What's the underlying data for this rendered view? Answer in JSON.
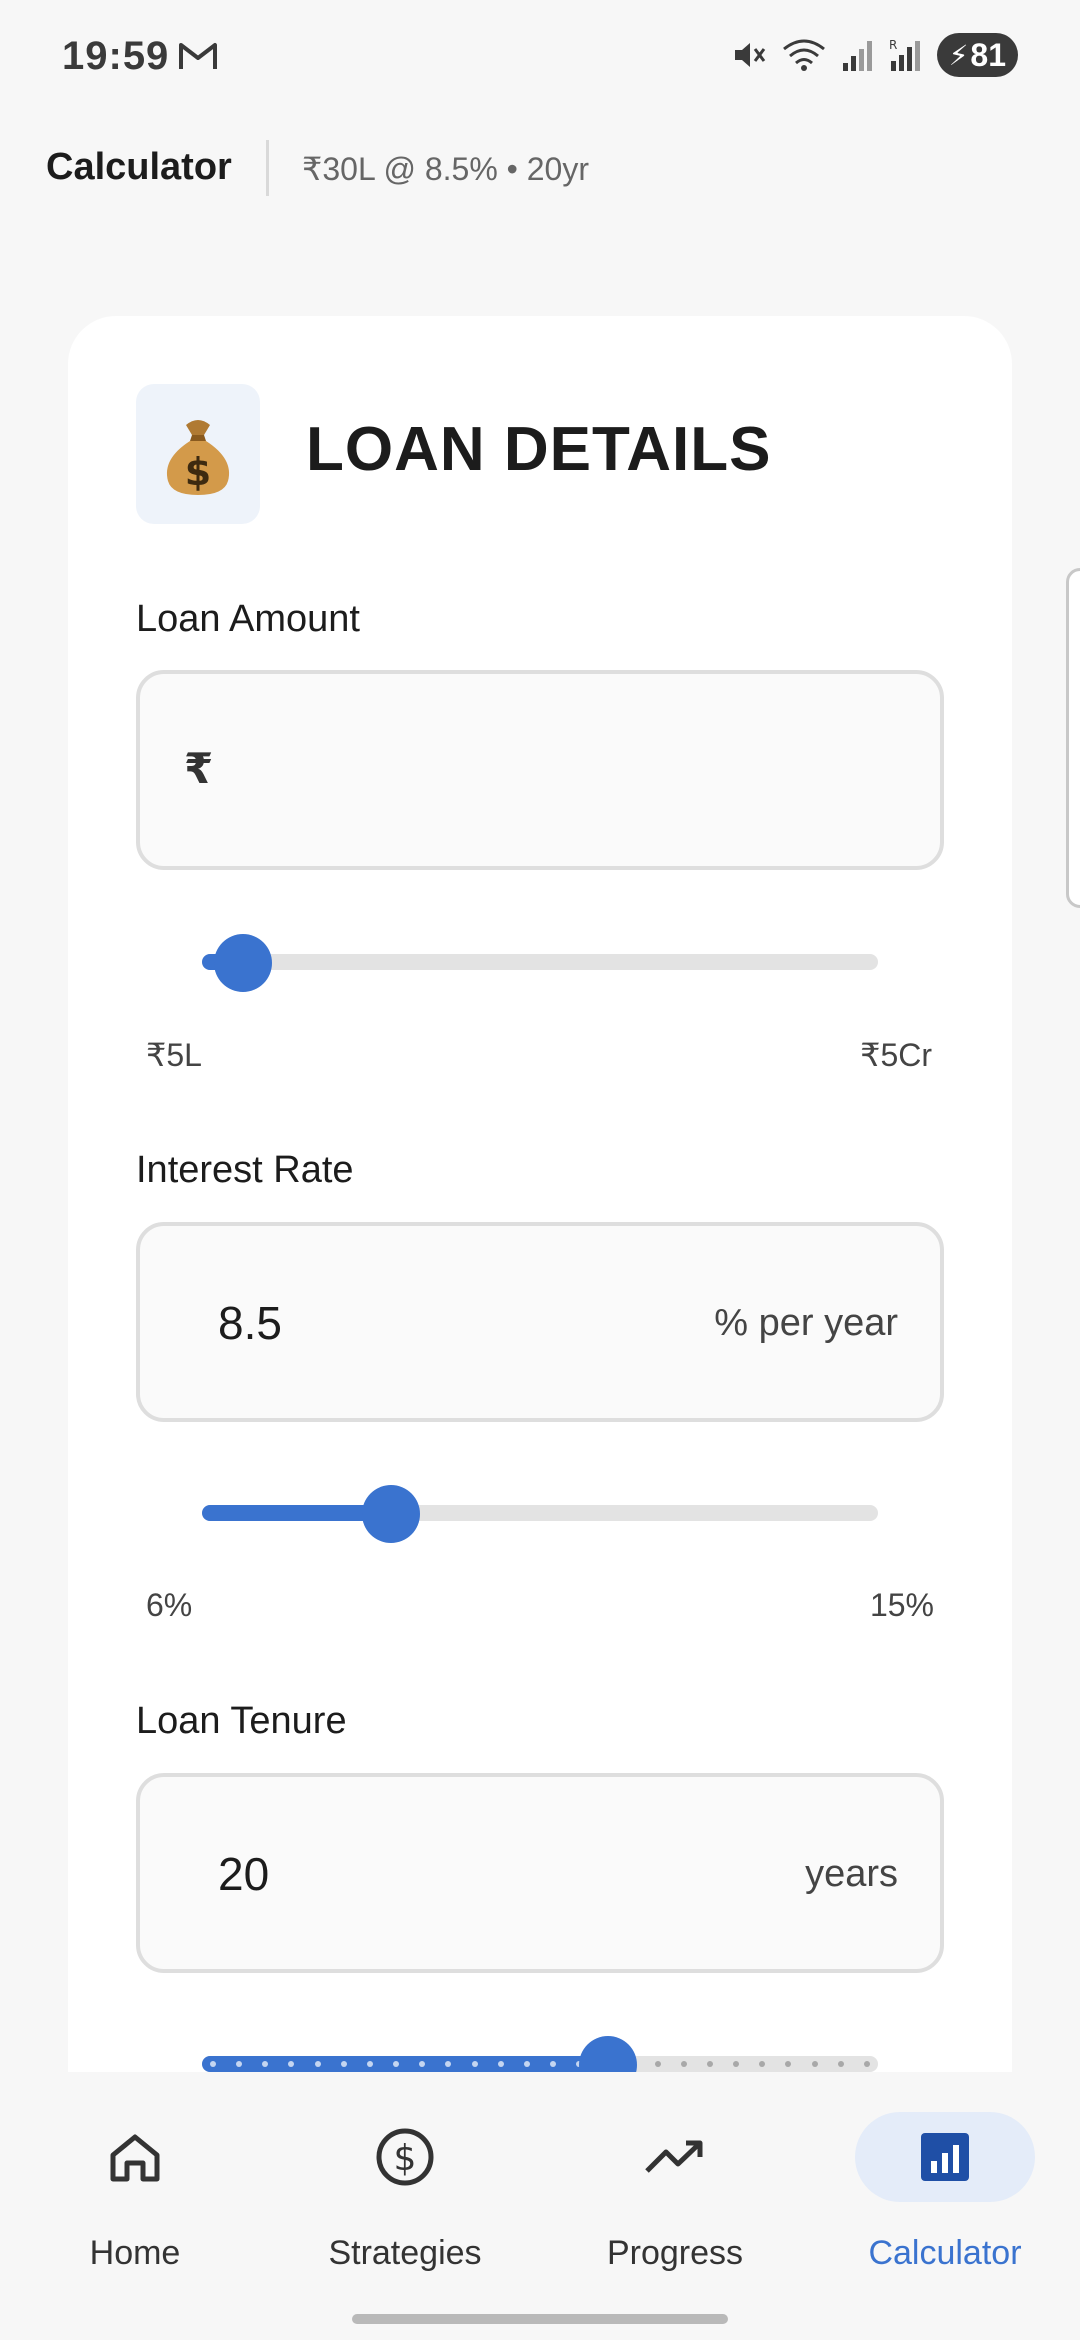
{
  "status_bar": {
    "time": "19:59",
    "icons": [
      "gmail-icon",
      "mute-icon",
      "wifi-icon",
      "signal-icon",
      "signal-roaming-icon"
    ],
    "battery_level": "81"
  },
  "header": {
    "title": "Calculator",
    "summary": "₹30L @ 8.5% • 20yr"
  },
  "section": {
    "icon": "money-bag-icon",
    "title": "LOAN DETAILS"
  },
  "loan_amount": {
    "label": "Loan Amount",
    "prefix": "₹",
    "value": "",
    "slider_fraction": 0.06,
    "min_label": "₹5L",
    "max_label": "₹5Cr"
  },
  "interest_rate": {
    "label": "Interest Rate",
    "value": "8.5",
    "suffix": "% per year",
    "slider_fraction": 0.28,
    "min_label": "6%",
    "max_label": "15%"
  },
  "loan_tenure": {
    "label": "Loan Tenure",
    "value": "20",
    "suffix": "years",
    "slider_fraction": 0.6
  },
  "nav": {
    "items": [
      {
        "label": "Home",
        "icon": "home-icon"
      },
      {
        "label": "Strategies",
        "icon": "dollar-circle-icon"
      },
      {
        "label": "Progress",
        "icon": "trending-up-icon"
      },
      {
        "label": "Calculator",
        "icon": "bar-chart-icon",
        "active": true
      }
    ]
  },
  "colors": {
    "accent": "#3a73cf",
    "accent_light": "#e4ecf9",
    "background": "#f7f7f7",
    "card": "#ffffff"
  }
}
